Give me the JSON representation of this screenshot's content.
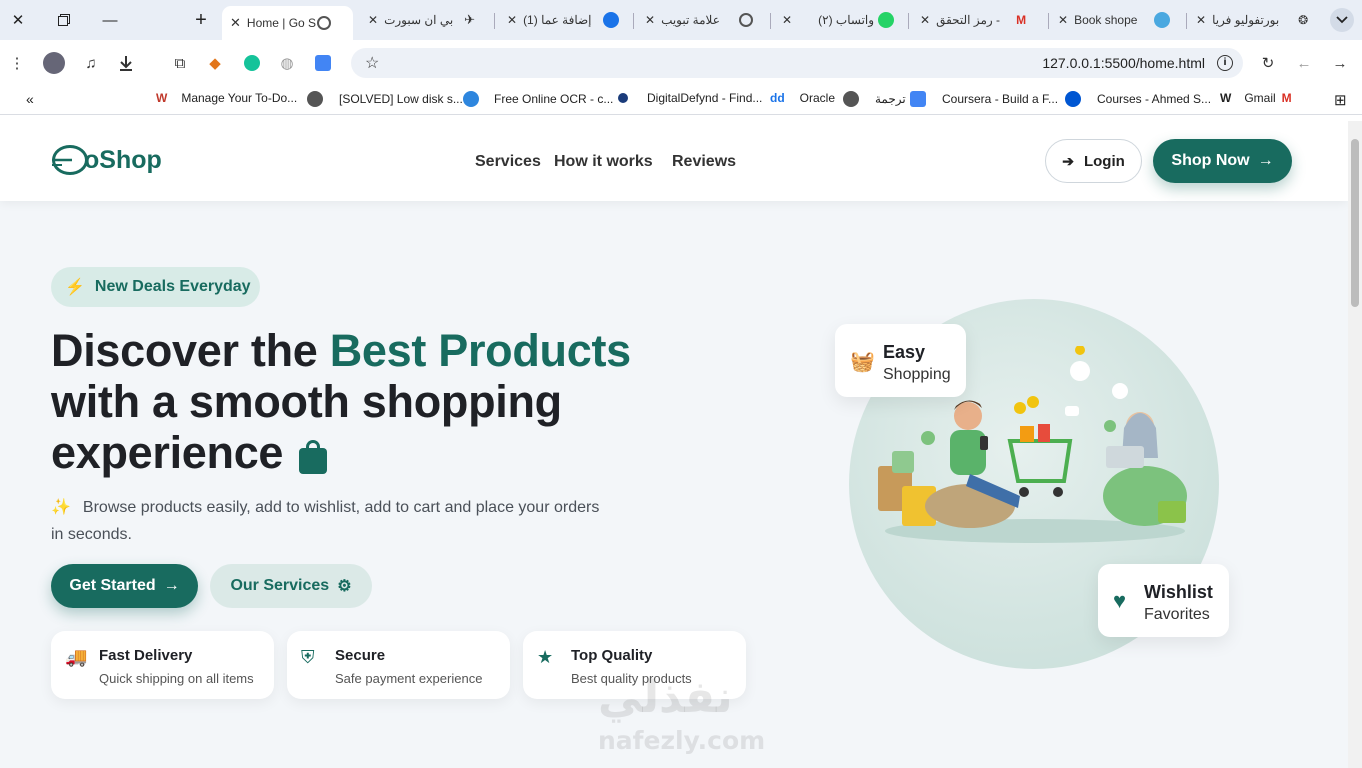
{
  "browser": {
    "tabs": [
      {
        "title": "Home | Go S",
        "active": true
      },
      {
        "title": "بي ان سبورت"
      },
      {
        "title": "(1) إضافة عما"
      },
      {
        "title": "علامة تبويب"
      },
      {
        "title": "(٢) واتساب"
      },
      {
        "title": "رمز التحقق -"
      },
      {
        "title": "Book shope"
      },
      {
        "title": "بورتفوليو فريا"
      }
    ],
    "url": "127.0.0.1:5500/home.html",
    "bookmarks": [
      "Manage Your To-Do...",
      "[SOLVED] Low disk s...",
      "Free Online OCR - c...",
      "DigitalDefynd - Find...",
      "Oracle",
      "ترجمة",
      "Coursera - Build a F...",
      "Courses - Ahmed S...",
      "Gmail"
    ],
    "bookmarks_collapse": "«"
  },
  "site": {
    "logo": "oShop",
    "nav": [
      "Services",
      "How it works",
      "Reviews"
    ],
    "login_label": "Login",
    "shop_label": "Shop Now",
    "badge": "New Deals Everyday",
    "headline_1": "Discover the ",
    "headline_highlight": "Best Products",
    "headline_2": "with a smooth shopping",
    "headline_3": "experience",
    "description": "Browse products easily, add to wishlist, add to cart and place your orders in seconds.",
    "get_started": "Get Started",
    "our_services": "Our Services",
    "features": [
      {
        "title": "Fast Delivery",
        "subtitle": "Quick shipping on all items"
      },
      {
        "title": "Secure",
        "subtitle": "Safe payment experience"
      },
      {
        "title": "Top Quality",
        "subtitle": "Best quality products"
      }
    ],
    "card_easy": {
      "title": "Easy",
      "subtitle": "Shopping"
    },
    "card_wishlist": {
      "title": "Wishlist",
      "subtitle": "Favorites"
    }
  },
  "watermark": {
    "arabic": "نفذلي",
    "latin": "nafezly.com"
  },
  "colors": {
    "brand": "#186b5f",
    "background": "#f3f6f9"
  }
}
